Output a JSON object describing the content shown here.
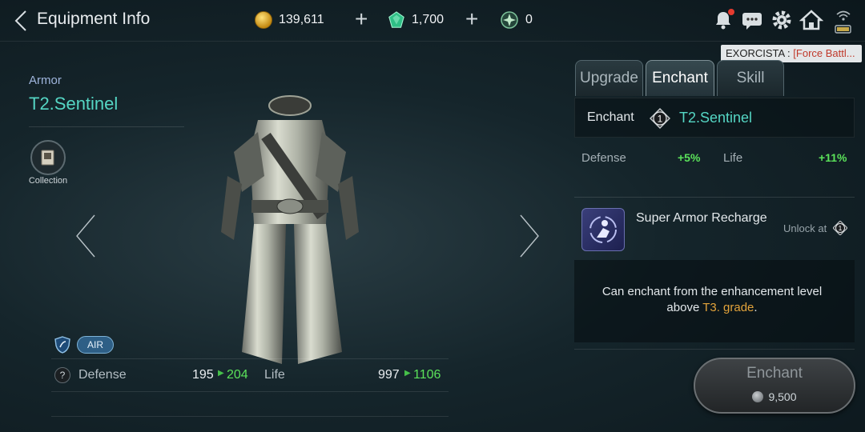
{
  "header": {
    "title": "Equipment Info",
    "gold": "139,611",
    "gems": "1,700",
    "seals": "0"
  },
  "tooltip": {
    "prefix": "EXORCISTA : ",
    "highlight": "[Force Battl..."
  },
  "item": {
    "type": "Armor",
    "name": "T2.Sentinel",
    "collection_label": "Collection",
    "element_badge": "AIR"
  },
  "stats": {
    "defense_label": "Defense",
    "defense_old": "195",
    "defense_new": "204",
    "life_label": "Life",
    "life_old": "997",
    "life_new": "1106"
  },
  "tabs": [
    "Upgrade",
    "Enchant",
    "Skill"
  ],
  "active_tab": "Enchant",
  "enchant": {
    "label": "Enchant",
    "level": "1",
    "item_name": "T2.Sentinel",
    "bonus": [
      {
        "label": "Defense",
        "value": "+5%"
      },
      {
        "label": "Life",
        "value": "+11%"
      }
    ],
    "skill_name": "Super Armor Recharge",
    "unlock_label": "Unlock at",
    "unlock_level": "1",
    "note_line1": "Can enchant from the enhancement level",
    "note_line2_prefix": "above ",
    "note_line2_highlight": "T3. grade",
    "note_line2_suffix": ".",
    "button_label": "Enchant",
    "cost": "9,500"
  },
  "colors": {
    "accent_teal": "#55d6c4",
    "stat_up_green": "#5be25a",
    "grade_orange": "#e2a33b",
    "notification_red": "#e53b2f"
  }
}
